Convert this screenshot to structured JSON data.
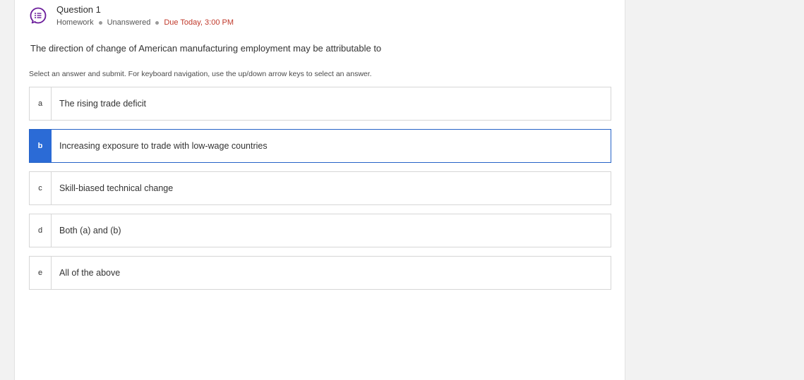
{
  "question": {
    "title": "Question 1",
    "type": "Homework",
    "status": "Unanswered",
    "due": "Due Today, 3:00 PM",
    "icon": "question-list-icon",
    "accent_color": "#6a1b9a",
    "due_color": "#c0392b"
  },
  "prompt": "The direction of change of American manufacturing employment may be attributable to",
  "instructions": "Select an answer and submit. For keyboard navigation, use the up/down arrow keys to select an answer.",
  "selection_color": "#2b6bd6",
  "selected_option": "b",
  "options": [
    {
      "letter": "a",
      "text": "The rising trade deficit"
    },
    {
      "letter": "b",
      "text": "Increasing exposure to trade with low-wage countries"
    },
    {
      "letter": "c",
      "text": "Skill-biased technical change"
    },
    {
      "letter": "d",
      "text": "Both (a) and (b)"
    },
    {
      "letter": "e",
      "text": "All of the above"
    }
  ]
}
